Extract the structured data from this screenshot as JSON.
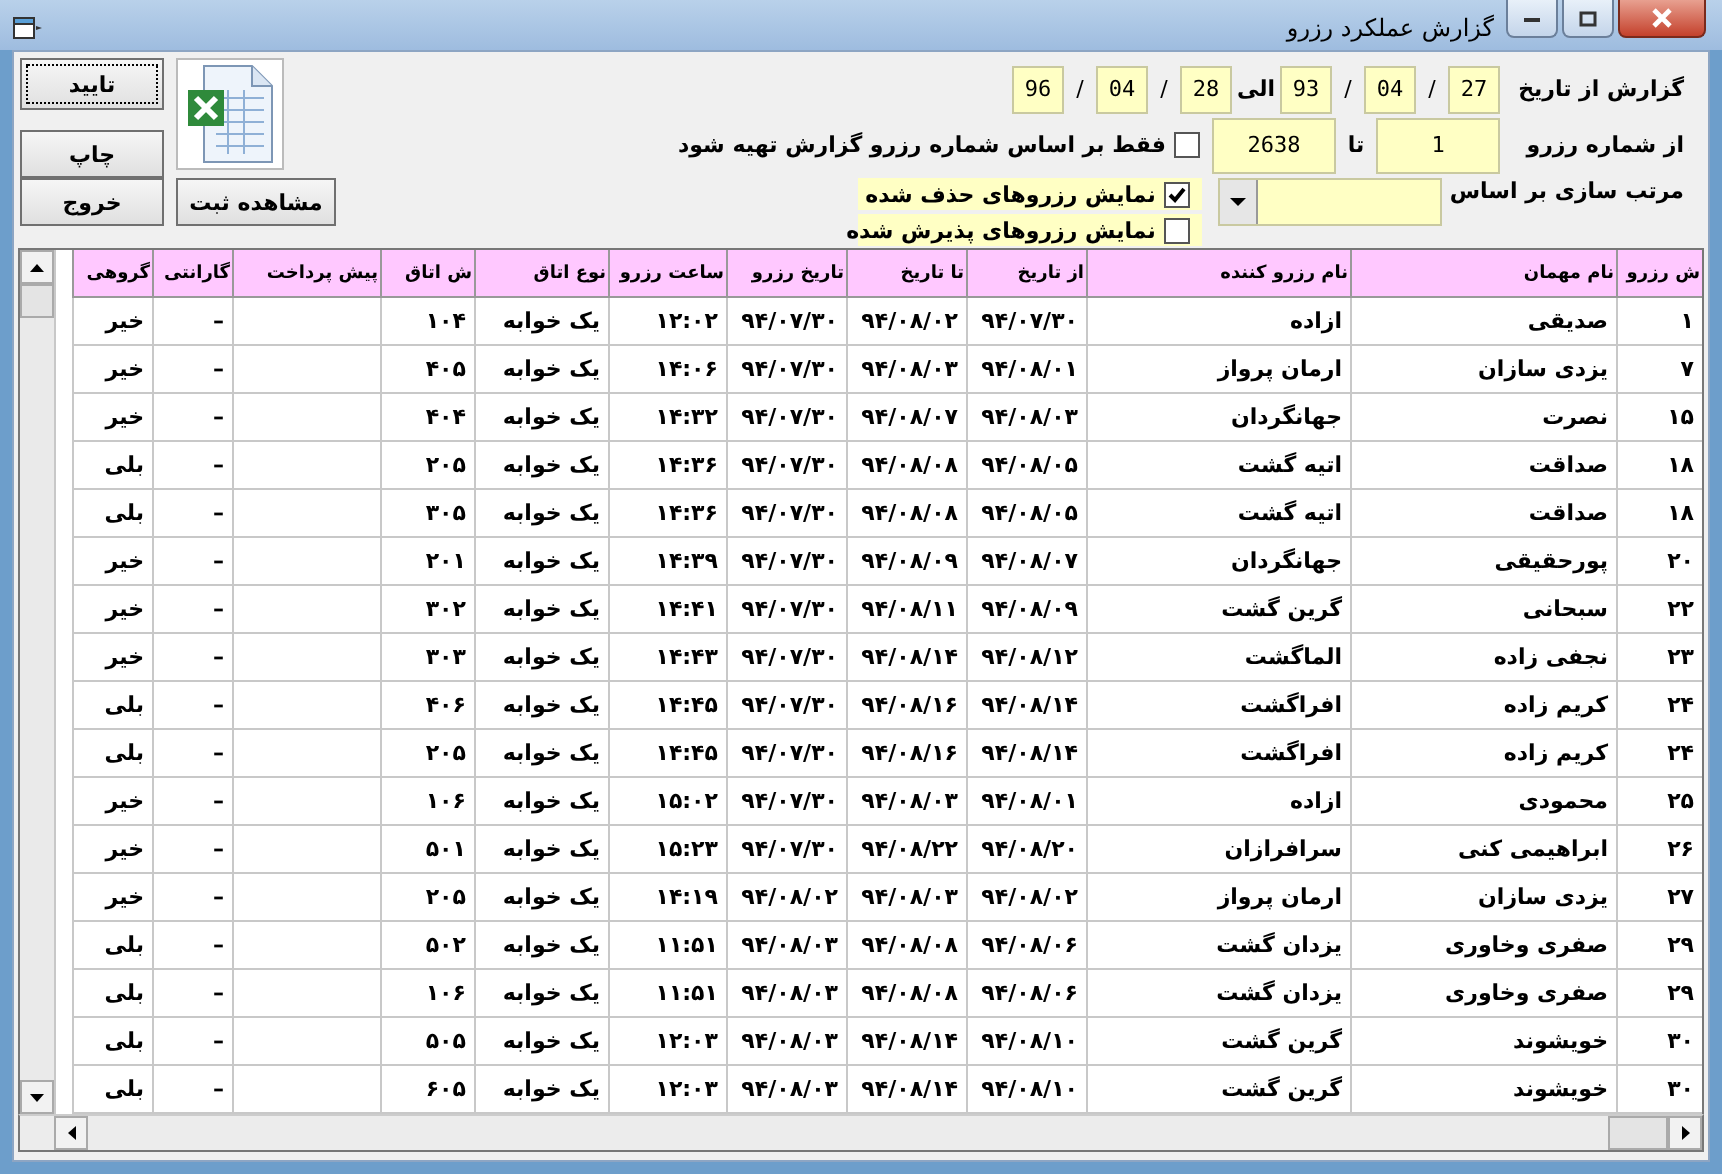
{
  "window": {
    "title": "گزارش عملکرد رزرو"
  },
  "buttons": {
    "confirm": "تایید",
    "print": "چاپ",
    "exit": "خروج",
    "view": "مشاهده ثبت"
  },
  "date_range": {
    "label": "گزارش از تاریخ",
    "to_label": "الی",
    "from": [
      {
        "kind": "field",
        "text": "27"
      },
      {
        "kind": "sep",
        "text": "/"
      },
      {
        "kind": "field",
        "text": "04"
      },
      {
        "kind": "sep",
        "text": "/"
      },
      {
        "kind": "field",
        "text": "93"
      }
    ],
    "to": [
      {
        "kind": "field",
        "text": "28"
      },
      {
        "kind": "sep",
        "text": "/"
      },
      {
        "kind": "field",
        "text": "04"
      },
      {
        "kind": "sep",
        "text": "/"
      },
      {
        "kind": "field",
        "text": "96"
      }
    ]
  },
  "number_range": {
    "label": "از شماره رزرو",
    "from": "1",
    "to_label": "تا",
    "to": "2638",
    "only_by_number": {
      "label": "فقط بر اساس شماره رزرو گزارش تهیه شود",
      "checked": false
    }
  },
  "sort": {
    "label": "مرتب سازی بر اساس"
  },
  "options": [
    {
      "label": "نمایش رزروهای حذف شده",
      "checked": true
    },
    {
      "label": "نمایش رزروهای پذیرش شده",
      "checked": false
    }
  ],
  "table": {
    "columns": [
      "ش رزرو",
      "نام مهمان",
      "نام رزرو کننده",
      "از تاریخ",
      "تا تاریخ",
      "تاریخ رزرو",
      "ساعت رزرو",
      "نوع اتاق",
      "ش اتاق",
      "پیش پرداخت",
      "گارانتی",
      "گروهی"
    ],
    "rows": [
      [
        "۱",
        "صدیقی",
        "ازاده",
        "۹۴/۰۷/۳۰",
        "۹۴/۰۸/۰۲",
        "۹۴/۰۷/۳۰",
        "۱۲:۰۲",
        "یک خوابه",
        "۱۰۴",
        null,
        "–",
        "خیر"
      ],
      [
        "۷",
        "یزدی سازان",
        "ارمان پرواز",
        "۹۴/۰۸/۰۱",
        "۹۴/۰۸/۰۳",
        "۹۴/۰۷/۳۰",
        "۱۴:۰۶",
        "یک خوابه",
        "۴۰۵",
        null,
        "–",
        "خیر"
      ],
      [
        "۱۵",
        "نصرت",
        "جهانگردان",
        "۹۴/۰۸/۰۳",
        "۹۴/۰۸/۰۷",
        "۹۴/۰۷/۳۰",
        "۱۴:۳۲",
        "یک خوابه",
        "۴۰۴",
        null,
        "–",
        "خیر"
      ],
      [
        "۱۸",
        "صداقت",
        "اتیه گشت",
        "۹۴/۰۸/۰۵",
        "۹۴/۰۸/۰۸",
        "۹۴/۰۷/۳۰",
        "۱۴:۳۶",
        "یک خوابه",
        "۲۰۵",
        null,
        "–",
        "بلی"
      ],
      [
        "۱۸",
        "صداقت",
        "اتیه گشت",
        "۹۴/۰۸/۰۵",
        "۹۴/۰۸/۰۸",
        "۹۴/۰۷/۳۰",
        "۱۴:۳۶",
        "یک خوابه",
        "۳۰۵",
        null,
        "–",
        "بلی"
      ],
      [
        "۲۰",
        "پورحقیقی",
        "جهانگردان",
        "۹۴/۰۸/۰۷",
        "۹۴/۰۸/۰۹",
        "۹۴/۰۷/۳۰",
        "۱۴:۳۹",
        "یک خوابه",
        "۲۰۱",
        null,
        "–",
        "خیر"
      ],
      [
        "۲۲",
        "سبحانی",
        "گرین گشت",
        "۹۴/۰۸/۰۹",
        "۹۴/۰۸/۱۱",
        "۹۴/۰۷/۳۰",
        "۱۴:۴۱",
        "یک خوابه",
        "۳۰۲",
        null,
        "–",
        "خیر"
      ],
      [
        "۲۳",
        "نجفی زاده",
        "الماگشت",
        "۹۴/۰۸/۱۲",
        "۹۴/۰۸/۱۴",
        "۹۴/۰۷/۳۰",
        "۱۴:۴۳",
        "یک خوابه",
        "۳۰۳",
        null,
        "–",
        "خیر"
      ],
      [
        "۲۴",
        "کریم زاده",
        "افراگشت",
        "۹۴/۰۸/۱۴",
        "۹۴/۰۸/۱۶",
        "۹۴/۰۷/۳۰",
        "۱۴:۴۵",
        "یک خوابه",
        "۴۰۶",
        null,
        "–",
        "بلی"
      ],
      [
        "۲۴",
        "کریم زاده",
        "افراگشت",
        "۹۴/۰۸/۱۴",
        "۹۴/۰۸/۱۶",
        "۹۴/۰۷/۳۰",
        "۱۴:۴۵",
        "یک خوابه",
        "۲۰۵",
        null,
        "–",
        "بلی"
      ],
      [
        "۲۵",
        "محمودی",
        "ازاده",
        "۹۴/۰۸/۰۱",
        "۹۴/۰۸/۰۳",
        "۹۴/۰۷/۳۰",
        "۱۵:۰۲",
        "یک خوابه",
        "۱۰۶",
        null,
        "–",
        "خیر"
      ],
      [
        "۲۶",
        "ابراهیمی کنی",
        "سرافرازان",
        "۹۴/۰۸/۲۰",
        "۹۴/۰۸/۲۲",
        "۹۴/۰۷/۳۰",
        "۱۵:۲۳",
        "یک خوابه",
        "۵۰۱",
        null,
        "–",
        "خیر"
      ],
      [
        "۲۷",
        "یزدی سازان",
        "ارمان پرواز",
        "۹۴/۰۸/۰۲",
        "۹۴/۰۸/۰۳",
        "۹۴/۰۸/۰۲",
        "۱۴:۱۹",
        "یک خوابه",
        "۲۰۵",
        null,
        "–",
        "خیر"
      ],
      [
        "۲۹",
        "صفری وخاوری",
        "یزدان گشت",
        "۹۴/۰۸/۰۶",
        "۹۴/۰۸/۰۸",
        "۹۴/۰۸/۰۳",
        "۱۱:۵۱",
        "یک خوابه",
        "۵۰۲",
        null,
        "–",
        "بلی"
      ],
      [
        "۲۹",
        "صفری وخاوری",
        "یزدان گشت",
        "۹۴/۰۸/۰۶",
        "۹۴/۰۸/۰۸",
        "۹۴/۰۸/۰۳",
        "۱۱:۵۱",
        "یک خوابه",
        "۱۰۶",
        null,
        "–",
        "بلی"
      ],
      [
        "۳۰",
        "خویشوند",
        "گرین گشت",
        "۹۴/۰۸/۱۰",
        "۹۴/۰۸/۱۴",
        "۹۴/۰۸/۰۳",
        "۱۲:۰۳",
        "یک خوابه",
        "۵۰۵",
        null,
        "–",
        "بلی"
      ],
      [
        "۳۰",
        "خویشوند",
        "گرین گشت",
        "۹۴/۰۸/۱۰",
        "۹۴/۰۸/۱۴",
        "۹۴/۰۸/۰۳",
        "۱۲:۰۳",
        "یک خوابه",
        "۶۰۵",
        null,
        "–",
        "بلی"
      ]
    ]
  }
}
